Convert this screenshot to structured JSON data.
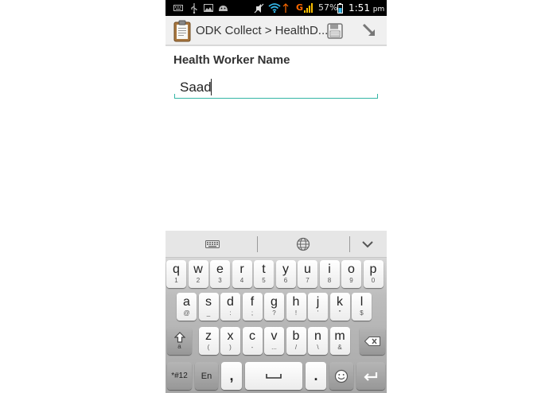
{
  "status_bar": {
    "network": "G",
    "battery_percent": "57%",
    "time": "1:51",
    "time_suffix": "pm",
    "icons": [
      "keyboard-icon",
      "usb-icon",
      "image-icon",
      "android-icon",
      "mute-icon",
      "wifi-icon",
      "signal-icon",
      "battery-icon"
    ]
  },
  "action_bar": {
    "title": "ODK Collect > HealthD...",
    "icons": [
      "clipboard-icon",
      "save-icon",
      "navigate-icon"
    ]
  },
  "form": {
    "question_label": "Health Worker Name",
    "answer_value": "Saad"
  },
  "keyboard": {
    "row1": [
      {
        "main": "q",
        "sub": "1"
      },
      {
        "main": "w",
        "sub": "2"
      },
      {
        "main": "e",
        "sub": "3"
      },
      {
        "main": "r",
        "sub": "4"
      },
      {
        "main": "t",
        "sub": "5"
      },
      {
        "main": "y",
        "sub": "6"
      },
      {
        "main": "u",
        "sub": "7"
      },
      {
        "main": "i",
        "sub": "8"
      },
      {
        "main": "o",
        "sub": "9"
      },
      {
        "main": "p",
        "sub": "0"
      }
    ],
    "row2": [
      {
        "main": "a",
        "sub": "@"
      },
      {
        "main": "s",
        "sub": "_"
      },
      {
        "main": "d",
        "sub": ":"
      },
      {
        "main": "f",
        "sub": ";"
      },
      {
        "main": "g",
        "sub": "?"
      },
      {
        "main": "h",
        "sub": "!"
      },
      {
        "main": "j",
        "sub": "'"
      },
      {
        "main": "k",
        "sub": "\""
      },
      {
        "main": "l",
        "sub": "$"
      }
    ],
    "row3": [
      {
        "main": "z",
        "sub": "("
      },
      {
        "main": "x",
        "sub": ")"
      },
      {
        "main": "c",
        "sub": "-"
      },
      {
        "main": "v",
        "sub": "..."
      },
      {
        "main": "b",
        "sub": "/"
      },
      {
        "main": "n",
        "sub": "\\"
      },
      {
        "main": "m",
        "sub": "&"
      }
    ],
    "shift_sub": "a",
    "symbols_label": "*#12",
    "lang_label": "En",
    "comma_label": ",",
    "period_label": ".",
    "icons": [
      "keyboard-icon",
      "globe-icon",
      "chevron-down-icon",
      "shift-icon",
      "backspace-icon",
      "space-icon",
      "emoji-icon",
      "enter-icon"
    ]
  },
  "colors": {
    "accent": "#33b5a5",
    "status_bar_bg": "#000000",
    "action_bar_bg": "#f0f0f0",
    "network_g": "#ff6a00",
    "signal_bars": "#ffbf00"
  }
}
